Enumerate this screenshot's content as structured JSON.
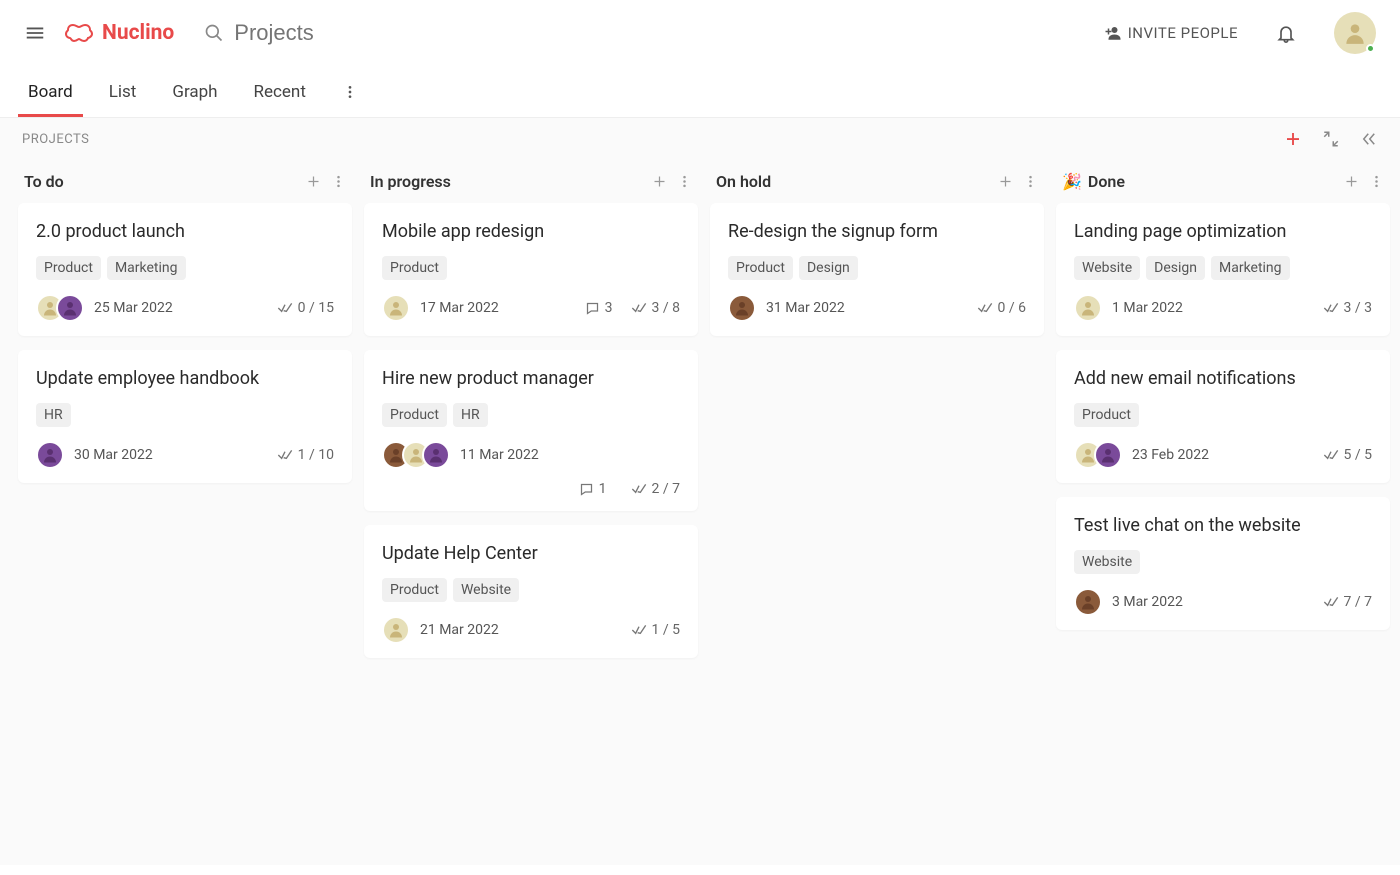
{
  "app": {
    "name": "Nuclino",
    "search_placeholder": "Projects",
    "invite_label": "INVITE PEOPLE"
  },
  "tabs": {
    "board": "Board",
    "list": "List",
    "graph": "Graph",
    "recent": "Recent",
    "active": "board"
  },
  "board": {
    "title": "PROJECTS",
    "columns": [
      {
        "id": "todo",
        "title": "To do",
        "emoji": "",
        "cards": [
          {
            "title": "2.0 product launch",
            "tags": [
              "Product",
              "Marketing"
            ],
            "avatars": [
              "#e6dfb8",
              "#7a4a9a"
            ],
            "date": "25 Mar 2022",
            "comments": null,
            "checklist": "0 / 15"
          },
          {
            "title": "Update employee handbook",
            "tags": [
              "HR"
            ],
            "avatars": [
              "#7a4a9a"
            ],
            "date": "30 Mar 2022",
            "comments": null,
            "checklist": "1 / 10"
          }
        ]
      },
      {
        "id": "inprogress",
        "title": "In progress",
        "emoji": "",
        "cards": [
          {
            "title": "Mobile app redesign",
            "tags": [
              "Product"
            ],
            "avatars": [
              "#e6dfb8"
            ],
            "date": "17 Mar 2022",
            "comments": "3",
            "checklist": "3 / 8"
          },
          {
            "title": "Hire new product manager",
            "tags": [
              "Product",
              "HR"
            ],
            "avatars": [
              "#8a5a3a",
              "#e6dfb8",
              "#7a4a9a"
            ],
            "date": "11 Mar 2022",
            "comments": "1",
            "checklist": "2 / 7",
            "wrap_meta": true
          },
          {
            "title": "Update Help Center",
            "tags": [
              "Product",
              "Website"
            ],
            "avatars": [
              "#e6dfb8"
            ],
            "date": "21 Mar 2022",
            "comments": null,
            "checklist": "1 / 5"
          }
        ]
      },
      {
        "id": "onhold",
        "title": "On hold",
        "emoji": "",
        "cards": [
          {
            "title": "Re-design the signup form",
            "tags": [
              "Product",
              "Design"
            ],
            "avatars": [
              "#8a5a3a"
            ],
            "date": "31 Mar 2022",
            "comments": null,
            "checklist": "0 / 6"
          }
        ]
      },
      {
        "id": "done",
        "title": "Done",
        "emoji": "🎉",
        "cards": [
          {
            "title": "Landing page optimization",
            "tags": [
              "Website",
              "Design",
              "Marketing"
            ],
            "avatars": [
              "#e6dfb8"
            ],
            "date": "1 Mar 2022",
            "comments": null,
            "checklist": "3 / 3"
          },
          {
            "title": "Add new email notifications",
            "tags": [
              "Product"
            ],
            "avatars": [
              "#e6dfb8",
              "#7a4a9a"
            ],
            "date": "23 Feb 2022",
            "comments": null,
            "checklist": "5 / 5"
          },
          {
            "title": "Test live chat on the website",
            "tags": [
              "Website"
            ],
            "avatars": [
              "#8a5a3a"
            ],
            "date": "3 Mar 2022",
            "comments": null,
            "checklist": "7 / 7"
          }
        ]
      }
    ]
  }
}
